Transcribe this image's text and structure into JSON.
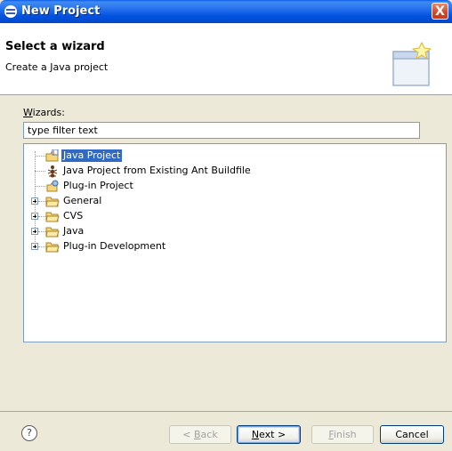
{
  "window": {
    "title": "New Project",
    "close_label": "X"
  },
  "banner": {
    "title": "Select a wizard",
    "subtitle": "Create a Java project"
  },
  "wizards": {
    "label_prefix": "W",
    "label_rest": "izards:",
    "filter_value": "type filter text"
  },
  "tree": {
    "items": [
      {
        "label": "Java Project",
        "icon": "java-project-icon",
        "selected": true
      },
      {
        "label": "Java Project from Existing Ant Buildfile",
        "icon": "ant-icon"
      },
      {
        "label": "Plug-in Project",
        "icon": "plugin-project-icon"
      },
      {
        "label": "General",
        "icon": "folder-icon",
        "expandable": true
      },
      {
        "label": "CVS",
        "icon": "folder-icon",
        "expandable": true
      },
      {
        "label": "Java",
        "icon": "folder-icon",
        "expandable": true
      },
      {
        "label": "Plug-in Development",
        "icon": "folder-icon",
        "expandable": true
      }
    ]
  },
  "buttons": {
    "help": "?",
    "back_prefix": "< ",
    "back_mnemonic": "B",
    "back_rest": "ack",
    "next_mnemonic": "N",
    "next_rest": "ext >",
    "finish_mnemonic": "F",
    "finish_rest": "inish",
    "cancel": "Cancel"
  },
  "colors": {
    "selection": "#316ac5",
    "titlebar": "#0052e0",
    "dialog": "#ece9d8"
  }
}
